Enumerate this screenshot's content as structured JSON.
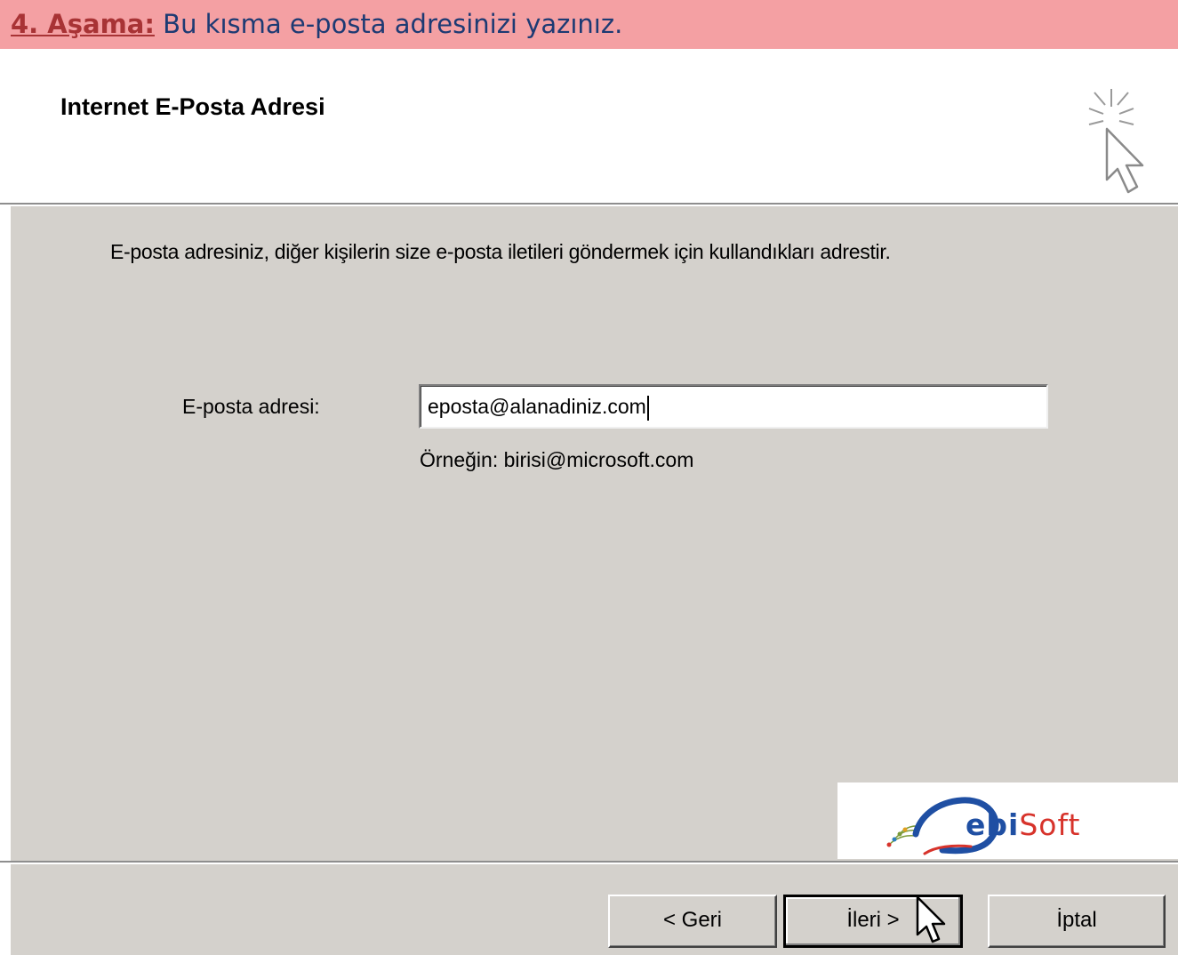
{
  "banner": {
    "step_label": "4. Aşama:",
    "step_text": " Bu kısma e-posta adresinizi yazınız."
  },
  "wizard": {
    "title": "Internet E-Posta Adresi",
    "intro": "E-posta adresiniz, diğer kişilerin size e-posta iletileri göndermek için kullandıkları adrestir.",
    "email_label": "E-posta adresi:",
    "email_value": "eposta@alanadiniz.com",
    "example": "Örneğin: birisi@microsoft.com"
  },
  "buttons": {
    "back": "< Geri",
    "next": "İleri >",
    "cancel": "İptal"
  },
  "brand": {
    "name_prefix": "ebi",
    "name_suffix": "Soft",
    "color_blue": "#1f4fa3",
    "color_red": "#d7332b"
  },
  "colors": {
    "banner_bg": "#f4a0a3",
    "dialog_bg": "#d4d1cc"
  }
}
